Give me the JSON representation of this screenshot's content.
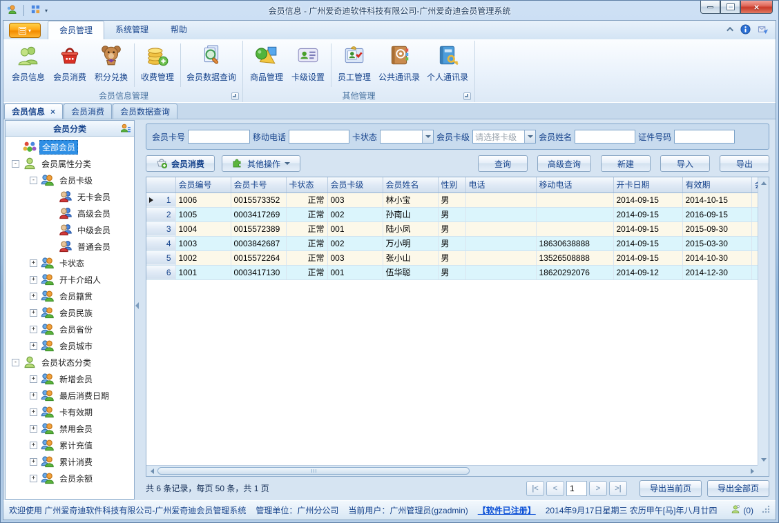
{
  "window": {
    "title": "会员信息 - 广州爱奇迪软件科技有限公司-广州爱奇迪会员管理系统"
  },
  "ribbon": {
    "tabs": [
      {
        "label": "会员管理",
        "active": true
      },
      {
        "label": "系统管理",
        "active": false
      },
      {
        "label": "帮助",
        "active": false
      }
    ],
    "groups": [
      {
        "label": "会员信息管理",
        "items": [
          {
            "label": "会员信息",
            "icon": "member-info-icon",
            "sep_after": false
          },
          {
            "label": "会员消费",
            "icon": "member-consume-icon",
            "sep_after": false
          },
          {
            "label": "积分兑换",
            "icon": "points-exchange-icon",
            "sep_after": true
          },
          {
            "label": "收费管理",
            "icon": "fee-manage-icon",
            "sep_after": true
          },
          {
            "label": "会员数据查询",
            "icon": "member-data-query-icon",
            "sep_after": false
          }
        ]
      },
      {
        "label": "其他管理",
        "items": [
          {
            "label": "商品管理",
            "icon": "goods-manage-icon",
            "sep_after": false
          },
          {
            "label": "卡级设置",
            "icon": "card-level-icon",
            "sep_after": true
          },
          {
            "label": "员工管理",
            "icon": "employee-manage-icon",
            "sep_after": false
          },
          {
            "label": "公共通讯录",
            "icon": "public-contacts-icon",
            "sep_after": false
          },
          {
            "label": "个人通讯录",
            "icon": "personal-contacts-icon",
            "sep_after": false
          }
        ]
      }
    ]
  },
  "doc_tabs": [
    {
      "label": "会员信息",
      "active": true,
      "closable": true
    },
    {
      "label": "会员消费",
      "active": false,
      "closable": false
    },
    {
      "label": "会员数据查询",
      "active": false,
      "closable": false
    }
  ],
  "sidebar": {
    "header": "会员分类",
    "tree": [
      {
        "label": "全部会员",
        "level": 0,
        "expand": "none",
        "icon": "all-members-icon",
        "selected": true
      },
      {
        "label": "会员属性分类",
        "level": 0,
        "expand": "minus",
        "icon": "category-icon"
      },
      {
        "label": "会员卡级",
        "level": 1,
        "expand": "minus",
        "icon": "subcategory-icon"
      },
      {
        "label": "无卡会员",
        "level": 2,
        "expand": "none",
        "icon": "leaf-member-icon"
      },
      {
        "label": "高级会员",
        "level": 2,
        "expand": "none",
        "icon": "leaf-member-icon"
      },
      {
        "label": "中级会员",
        "level": 2,
        "expand": "none",
        "icon": "leaf-member-icon"
      },
      {
        "label": "普通会员",
        "level": 2,
        "expand": "none",
        "icon": "leaf-member-icon"
      },
      {
        "label": "卡状态",
        "level": 1,
        "expand": "plus",
        "icon": "subcategory-icon"
      },
      {
        "label": "开卡介绍人",
        "level": 1,
        "expand": "plus",
        "icon": "subcategory-icon"
      },
      {
        "label": "会员籍贯",
        "level": 1,
        "expand": "plus",
        "icon": "subcategory-icon"
      },
      {
        "label": "会员民族",
        "level": 1,
        "expand": "plus",
        "icon": "subcategory-icon"
      },
      {
        "label": "会员省份",
        "level": 1,
        "expand": "plus",
        "icon": "subcategory-icon"
      },
      {
        "label": "会员城市",
        "level": 1,
        "expand": "plus",
        "icon": "subcategory-icon"
      },
      {
        "label": "会员状态分类",
        "level": 0,
        "expand": "minus",
        "icon": "category-icon"
      },
      {
        "label": "新增会员",
        "level": 1,
        "expand": "plus",
        "icon": "subcategory-icon"
      },
      {
        "label": "最后消费日期",
        "level": 1,
        "expand": "plus",
        "icon": "subcategory-icon"
      },
      {
        "label": "卡有效期",
        "level": 1,
        "expand": "plus",
        "icon": "subcategory-icon"
      },
      {
        "label": "禁用会员",
        "level": 1,
        "expand": "plus",
        "icon": "subcategory-icon"
      },
      {
        "label": "累计充值",
        "level": 1,
        "expand": "plus",
        "icon": "subcategory-icon"
      },
      {
        "label": "累计消费",
        "level": 1,
        "expand": "plus",
        "icon": "subcategory-icon"
      },
      {
        "label": "会员余额",
        "level": 1,
        "expand": "plus",
        "icon": "subcategory-icon"
      }
    ]
  },
  "search": {
    "fields": [
      {
        "name": "card-no",
        "label": "会员卡号",
        "type": "text",
        "value": "",
        "width": 90
      },
      {
        "name": "mobile",
        "label": "移动电话",
        "type": "text",
        "value": "",
        "width": 88
      },
      {
        "name": "card-status",
        "label": "卡状态",
        "type": "select",
        "value": "",
        "placeholder": false,
        "width": 78
      },
      {
        "name": "card-level",
        "label": "会员卡级",
        "type": "select",
        "value": "请选择卡级",
        "placeholder": true,
        "width": 92
      },
      {
        "name": "member-name",
        "label": "会员姓名",
        "type": "text",
        "value": "",
        "width": 88
      },
      {
        "name": "id-number",
        "label": "证件号码",
        "type": "text",
        "value": "",
        "width": 88
      }
    ]
  },
  "toolbar": {
    "consume_label": "会员消费",
    "more_label": "其他操作",
    "buttons": [
      "查询",
      "高级查询",
      "新建",
      "导入",
      "导出"
    ]
  },
  "table": {
    "columns": [
      {
        "label": "会员编号",
        "width": 80
      },
      {
        "label": "会员卡号",
        "width": 80
      },
      {
        "label": "卡状态",
        "width": 60,
        "align": "right"
      },
      {
        "label": "会员卡级",
        "width": 80
      },
      {
        "label": "会员姓名",
        "width": 80
      },
      {
        "label": "性别",
        "width": 40
      },
      {
        "label": "电话",
        "width": 102
      },
      {
        "label": "移动电话",
        "width": 112
      },
      {
        "label": "开卡日期",
        "width": 100
      },
      {
        "label": "有效期",
        "width": 100
      },
      {
        "label": "会员",
        "width": 60
      }
    ],
    "rows": [
      {
        "num": 1,
        "current": true,
        "cells": [
          "1006",
          "0015573352",
          "正常",
          "003",
          "林小宝",
          "男",
          "",
          "",
          "2014-09-15",
          "2014-10-15",
          ""
        ]
      },
      {
        "num": 2,
        "current": false,
        "cells": [
          "1005",
          "0003417269",
          "正常",
          "002",
          "孙南山",
          "男",
          "",
          "",
          "2014-09-15",
          "2016-09-15",
          ""
        ]
      },
      {
        "num": 3,
        "current": false,
        "cells": [
          "1004",
          "0015572389",
          "正常",
          "001",
          "陆小凤",
          "男",
          "",
          "",
          "2014-09-15",
          "2015-09-30",
          ""
        ]
      },
      {
        "num": 4,
        "current": false,
        "cells": [
          "1003",
          "0003842687",
          "正常",
          "002",
          "万小明",
          "男",
          "",
          "18630638888",
          "2014-09-15",
          "2015-03-30",
          ""
        ]
      },
      {
        "num": 5,
        "current": false,
        "cells": [
          "1002",
          "0015572264",
          "正常",
          "003",
          "张小山",
          "男",
          "",
          "13526508888",
          "2014-09-15",
          "2014-10-30",
          ""
        ]
      },
      {
        "num": 6,
        "current": false,
        "cells": [
          "1001",
          "0003417130",
          "正常",
          "001",
          "伍华聪",
          "男",
          "",
          "18620292076",
          "2014-09-12",
          "2014-12-30",
          ""
        ]
      }
    ]
  },
  "pager": {
    "summary": "共 6 条记录，每页 50 条，共 1 页",
    "first": "|<",
    "prev": "<",
    "page": "1",
    "next": ">",
    "last": ">|",
    "export_current": "导出当前页",
    "export_all": "导出全部页"
  },
  "statusbar": {
    "welcome": "欢迎使用 广州爱奇迪软件科技有限公司-广州爱奇迪会员管理系统",
    "org": "管理单位：广州分公司",
    "user": "当前用户：广州管理员(gzadmin)",
    "license": "【软件已注册】",
    "datetime": "2014年9月17日星期三 农历甲午[马]年八月廿四",
    "online_count": "(0)"
  }
}
